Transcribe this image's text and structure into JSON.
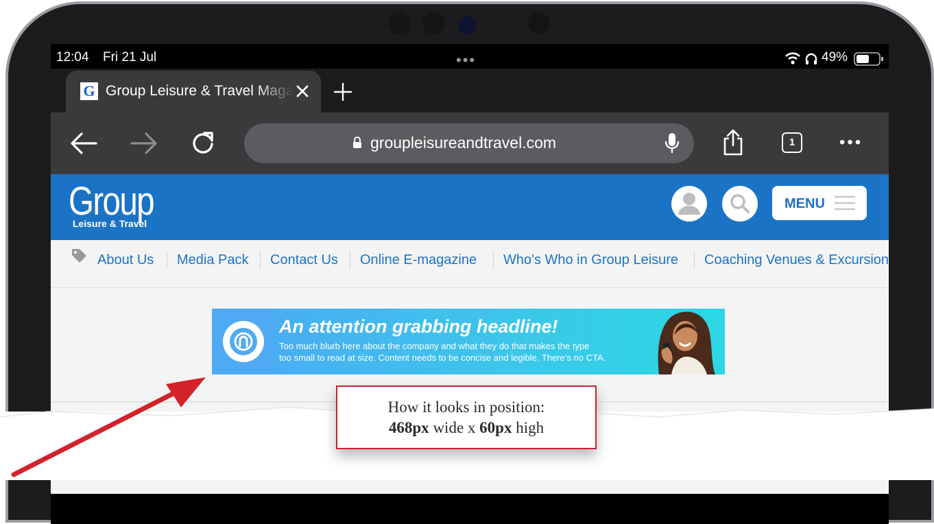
{
  "status_bar": {
    "time": "12:04",
    "date": "Fri 21 Jul",
    "battery": "49%"
  },
  "tabs": [
    {
      "favicon": "G",
      "title": "Group Leisure & Travel Magazine"
    }
  ],
  "toolbar": {
    "url": "groupleisureandtravel.com",
    "tab_count": "1"
  },
  "site": {
    "logo_main": "Group",
    "logo_sub": "Leisure & Travel",
    "menu_label": "MENU",
    "nav_links": [
      "About Us",
      "Media Pack",
      "Contact Us",
      "Online E-magazine",
      "Who's Who in Group Leisure",
      "Coaching Venues & Excursions"
    ]
  },
  "banner": {
    "headline": "An attention grabbing headline!",
    "copy_line1": "Too much blurb here about the company and what they do that makes the type",
    "copy_line2": "too small to read at size. Content needs to be concise and legible. There’s no CTA."
  },
  "callout": {
    "line1": "How it looks in position:",
    "width_value": "468px",
    "width_word": "wide x",
    "height_value": "60px",
    "height_word": "high"
  },
  "colors": {
    "brand_blue": "#1b73c6",
    "banner_cyan": "#3cc7ea",
    "callout_red": "#c32332",
    "arrow_red": "#d2232a"
  }
}
